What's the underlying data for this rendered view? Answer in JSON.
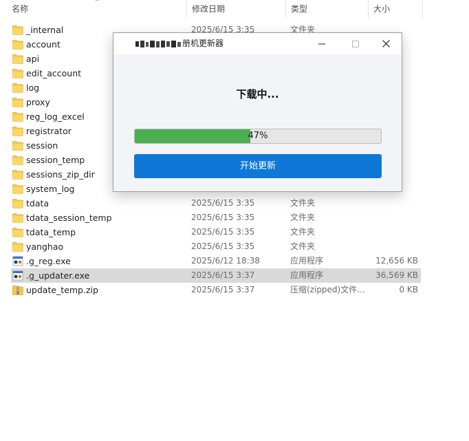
{
  "explorer": {
    "columns": [
      "名称",
      "修改日期",
      "类型",
      "大小"
    ],
    "rows": [
      {
        "name": "_internal",
        "date": "2025/6/15 3:35",
        "type": "文件夹",
        "size": "",
        "icon": "folder-icon"
      },
      {
        "name": "account",
        "date": "",
        "type": "",
        "size": "",
        "icon": "folder-icon"
      },
      {
        "name": "api",
        "date": "",
        "type": "",
        "size": "",
        "icon": "folder-icon"
      },
      {
        "name": "edit_account",
        "date": "",
        "type": "",
        "size": "",
        "icon": "folder-icon"
      },
      {
        "name": "log",
        "date": "",
        "type": "",
        "size": "",
        "icon": "folder-icon"
      },
      {
        "name": "proxy",
        "date": "",
        "type": "",
        "size": "",
        "icon": "folder-icon"
      },
      {
        "name": "reg_log_excel",
        "date": "",
        "type": "",
        "size": "",
        "icon": "folder-icon"
      },
      {
        "name": "registrator",
        "date": "",
        "type": "",
        "size": "",
        "icon": "folder-icon"
      },
      {
        "name": "session",
        "date": "",
        "type": "",
        "size": "",
        "icon": "folder-icon"
      },
      {
        "name": "session_temp",
        "date": "",
        "type": "",
        "size": "",
        "icon": "folder-icon"
      },
      {
        "name": "sessions_zip_dir",
        "date": "",
        "type": "",
        "size": "",
        "icon": "folder-icon"
      },
      {
        "name": "system_log",
        "date": "",
        "type": "",
        "size": "",
        "icon": "folder-icon"
      },
      {
        "name": "tdata",
        "date": "2025/6/15 3:35",
        "type": "文件夹",
        "size": "",
        "icon": "folder-icon"
      },
      {
        "name": "tdata_session_temp",
        "date": "2025/6/15 3:35",
        "type": "文件夹",
        "size": "",
        "icon": "folder-icon"
      },
      {
        "name": "tdata_temp",
        "date": "2025/6/15 3:35",
        "type": "文件夹",
        "size": "",
        "icon": "folder-icon"
      },
      {
        "name": "yanghao",
        "date": "2025/6/15 3:35",
        "type": "文件夹",
        "size": "",
        "icon": "folder-icon"
      },
      {
        "name": ".g_reg.exe",
        "date": "2025/6/12 18:38",
        "type": "应用程序",
        "size": "12,656 KB",
        "icon": "exe-icon"
      },
      {
        "name": ".g_updater.exe",
        "date": "2025/6/15 3:37",
        "type": "应用程序",
        "size": "36,569 KB",
        "icon": "exe-icon",
        "selected": true
      },
      {
        "name": "update_temp.zip",
        "date": "2025/6/15 3:37",
        "type": "压缩(zipped)文件...",
        "size": "0 KB",
        "icon": "zip-icon"
      }
    ]
  },
  "dialog": {
    "title": "册机更新器",
    "heading": "下载中...",
    "progress_value": 0.47,
    "progress_text": "47%",
    "button_label": "开始更新"
  },
  "colors": {
    "progress_fill": "#4caf50",
    "button_bg": "#0f78d7",
    "selected_row": "#d9d9d9",
    "folder": "#f6c94c"
  }
}
